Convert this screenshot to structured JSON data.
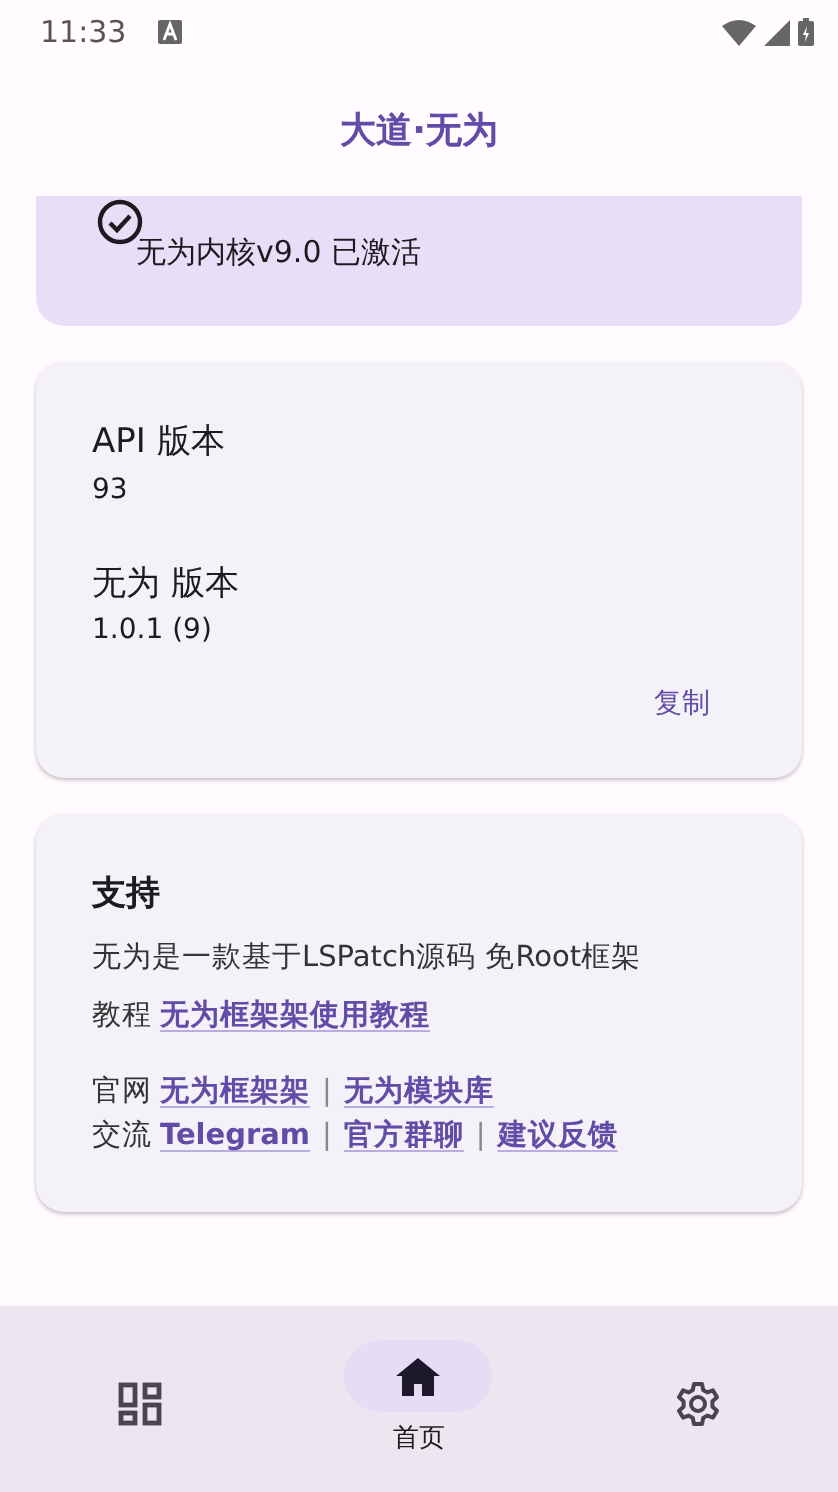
{
  "status_bar": {
    "time": "11:33"
  },
  "app_bar": {
    "title": "大道·无为"
  },
  "status_card": {
    "activated": true,
    "text": "无为内核v9.0 已激活"
  },
  "info_card": {
    "items": [
      {
        "label": "API 版本",
        "value": "93"
      },
      {
        "label": "无为 版本",
        "value": "1.0.1 (9)"
      }
    ],
    "action": "复制"
  },
  "support_card": {
    "title": "支持",
    "description": "无为是一款基于LSPatch源码 免Root框架",
    "lines": [
      {
        "label": "教程",
        "items": [
          {
            "kind": "link",
            "text": "无为框架架使用教程"
          }
        ]
      },
      {
        "label": "官网",
        "items": [
          {
            "kind": "link",
            "text": "无为框架架"
          },
          {
            "kind": "separator",
            "text": "|"
          },
          {
            "kind": "link",
            "text": "无为模块库"
          }
        ]
      },
      {
        "label": "交流",
        "items": [
          {
            "kind": "link",
            "text": "Telegram"
          },
          {
            "kind": "separator",
            "text": "|"
          },
          {
            "kind": "link",
            "text": "官方群聊"
          },
          {
            "kind": "separator",
            "text": "|"
          },
          {
            "kind": "link",
            "text": "建议反馈"
          }
        ]
      }
    ]
  },
  "bottom_nav": [
    {
      "kind": "modules",
      "selected": false
    },
    {
      "kind": "home",
      "label": "首页",
      "selected": true
    },
    {
      "kind": "settings",
      "selected": false
    }
  ]
}
